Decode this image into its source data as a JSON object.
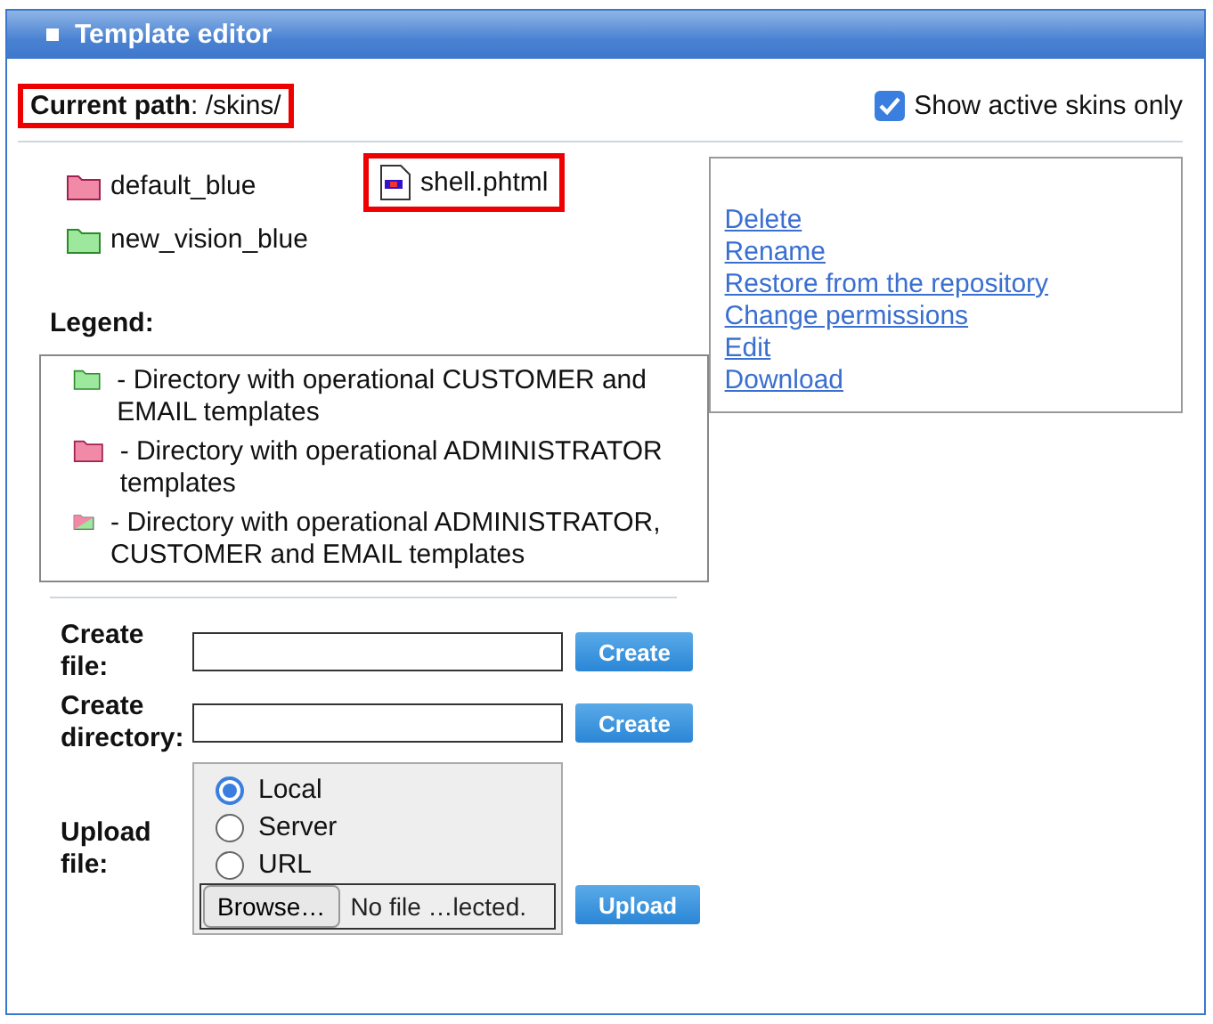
{
  "window": {
    "title": "Template editor"
  },
  "current_path": {
    "label": "Current path",
    "value": ": /skins/"
  },
  "active_only": {
    "label": "Show active skins only",
    "checked": true
  },
  "items": [
    {
      "name": "default_blue",
      "kind": "admin",
      "selected": false
    },
    {
      "name": "shell.phtml",
      "kind": "file",
      "selected": true
    },
    {
      "name": "new_vision_blue",
      "kind": "customer",
      "selected": false
    }
  ],
  "actions": [
    "Delete",
    "Rename",
    "Restore from the repository",
    "Change permissions",
    "Edit",
    "Download"
  ],
  "legend": {
    "title": "Legend:",
    "entries": [
      {
        "kind": "customer",
        "text": "- Directory with operational CUSTOMER and EMAIL templates"
      },
      {
        "kind": "admin",
        "text": "- Directory with operational ADMINISTRATOR templates"
      },
      {
        "kind": "both",
        "text": "- Directory with operational ADMINISTRATOR, CUSTOMER and EMAIL templates"
      }
    ]
  },
  "create_file": {
    "label": "Create file:",
    "button": "Create"
  },
  "create_directory": {
    "label": "Create directory:",
    "button": "Create"
  },
  "upload": {
    "label": "Upload file:",
    "sources": [
      {
        "label": "Local",
        "selected": true
      },
      {
        "label": "Server",
        "selected": false
      },
      {
        "label": "URL",
        "selected": false
      }
    ],
    "browse": "Browse…",
    "file_status": "No file …lected.",
    "button": "Upload"
  }
}
